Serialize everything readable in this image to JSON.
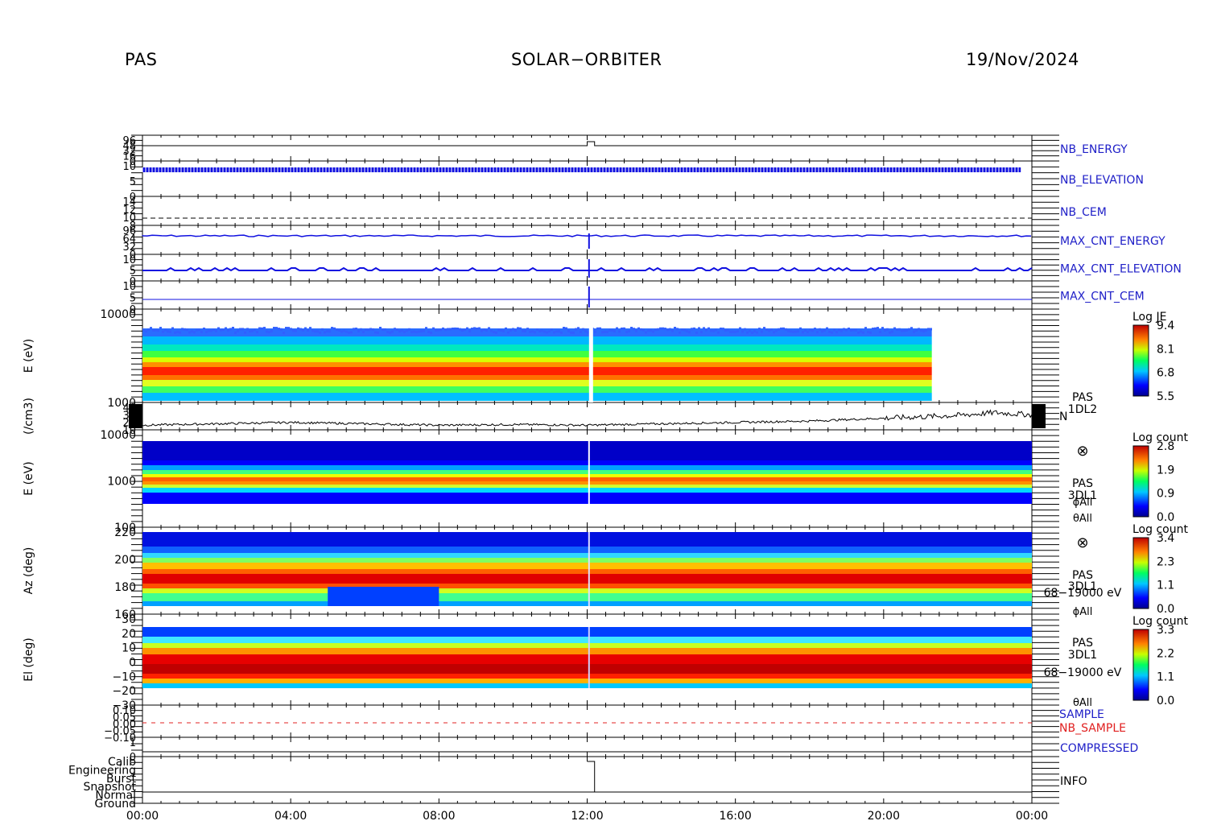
{
  "header": {
    "instrument": "PAS",
    "mission": "SOLAR−ORBITER",
    "date": "19/Nov/2024"
  },
  "colors": {
    "blue_label": "#2020c8",
    "red_label": "#e02020"
  },
  "chart_data": {
    "type": "heatmap",
    "x_ticks": [
      "00:00",
      "04:00",
      "08:00",
      "12:00",
      "16:00",
      "20:00",
      "00:00"
    ],
    "x_range_hours": [
      0,
      24
    ],
    "panels": [
      {
        "key": "nb_energy",
        "type": "line",
        "right_label": "NB_ENERGY",
        "label_color": "#2020c8",
        "tick_labels": [
          "96",
          "48",
          "32",
          "16",
          "0"
        ],
        "note": "step up near 12:00",
        "series": [
          {
            "x": [
              0,
              12.0,
              12.0,
              12.2,
              12.2,
              24
            ],
            "y": [
              0,
              0,
              1,
              1,
              0,
              0
            ]
          }
        ]
      },
      {
        "key": "nb_elevation",
        "type": "line",
        "right_label": "NB_ELEVATION",
        "label_color": "#2020c8",
        "tick_labels": [
          "10",
          "5",
          "0"
        ],
        "series": [
          {
            "x": [
              0,
              23.7
            ],
            "y": [
              9,
              9
            ]
          }
        ]
      },
      {
        "key": "nb_cem",
        "type": "line",
        "right_label": "NB_CEM",
        "label_color": "#2020c8",
        "tick_labels": [
          "14",
          "12",
          "10",
          "8"
        ],
        "series": [
          {
            "x": [
              0,
              24
            ],
            "y": [
              9,
              9
            ]
          }
        ]
      },
      {
        "key": "max_cnt_energy",
        "type": "line",
        "right_label": "MAX_CNT_ENERGY",
        "label_color": "#2020c8",
        "tick_labels": [
          "96",
          "64",
          "32",
          "0"
        ],
        "series": [
          {
            "x": [
              0,
              24
            ],
            "y": [
              60,
              60
            ]
          }
        ]
      },
      {
        "key": "max_cnt_elevation",
        "type": "line",
        "right_label": "MAX_CNT_ELEVATION",
        "label_color": "#2020c8",
        "tick_labels": [
          "10",
          "5",
          "0"
        ],
        "series": [
          {
            "x": [
              0,
              24
            ],
            "y": [
              5,
              5
            ]
          }
        ]
      },
      {
        "key": "max_cnt_cem",
        "type": "line",
        "right_label": "MAX_CNT_CEM",
        "label_color": "#2020c8",
        "tick_labels": [
          "10",
          "5",
          "0"
        ],
        "series": [
          {
            "x": [
              0,
              24
            ],
            "y": [
              2,
              2
            ]
          }
        ]
      },
      {
        "key": "je_spectrogram",
        "type": "heatmap",
        "ylabel": "E (eV)",
        "yscale": "log",
        "tick_labels": [
          "10000",
          "1000"
        ],
        "colorbar_title": "Log JE",
        "colorbar_ticks": [
          "9.4",
          "8.1",
          "6.8",
          "5.5"
        ],
        "data_end_hour": 21.3
      },
      {
        "key": "density",
        "type": "line",
        "ylabel": "(/cm3)",
        "right_label_lines": [
          "PAS",
          "1DL2"
        ],
        "right_inline": "N",
        "tick_labels": [
          "40",
          "30",
          "20",
          "10"
        ],
        "series": [
          {
            "x": [
              0,
              2,
              4,
              6,
              8,
              10,
              12,
              14,
              16,
              18,
              20,
              22,
              23,
              24
            ],
            "y": [
              12,
              14,
              16,
              14,
              12,
              13,
              12,
              14,
              16,
              18,
              22,
              26,
              30,
              27
            ]
          }
        ]
      },
      {
        "key": "count_energy",
        "type": "heatmap",
        "ylabel": "E (eV)",
        "yscale": "log",
        "tick_labels": [
          "10000",
          "1000",
          "100"
        ],
        "right_label_lines": [
          "PAS",
          "3DL1"
        ],
        "right_sub": [
          "ϕAll",
          "θAll"
        ],
        "colorbar_title": "Log count",
        "colorbar_ticks": [
          "2.8",
          "1.9",
          "0.9",
          "0.0"
        ]
      },
      {
        "key": "azimuth",
        "type": "heatmap",
        "ylabel": "Az (deg)",
        "tick_labels": [
          "220",
          "200",
          "180",
          "160"
        ],
        "right_label_lines": [
          "PAS",
          "3DL1"
        ],
        "right_energy": "68−19000 eV",
        "right_sub": [
          "ϕAll"
        ],
        "colorbar_title": "Log count",
        "colorbar_ticks": [
          "3.4",
          "2.3",
          "1.1",
          "0.0"
        ]
      },
      {
        "key": "elevation",
        "type": "heatmap",
        "ylabel": "El (deg)",
        "tick_labels": [
          "30",
          "20",
          "10",
          "0",
          "−10",
          "−20",
          "−30"
        ],
        "right_label_lines": [
          "PAS",
          "3DL1"
        ],
        "right_energy": "68−19000 eV",
        "right_sub": [
          "θAll"
        ],
        "colorbar_title": "Log count",
        "colorbar_ticks": [
          "3.3",
          "2.2",
          "1.1",
          "0.0"
        ]
      },
      {
        "key": "sample",
        "type": "line",
        "right_labels": [
          "SAMPLE",
          "NB_SAMPLE"
        ],
        "tick_labels": [
          "0.10",
          "0.05",
          "0.00",
          "−0.05",
          "−0.10"
        ]
      },
      {
        "key": "compressed",
        "type": "line",
        "right_label": "COMPRESSED",
        "label_color": "#2020c8",
        "tick_labels": [
          "1",
          "0"
        ]
      },
      {
        "key": "info",
        "type": "line",
        "right_label": "INFO",
        "label_color": "#000000",
        "tick_labels": [
          "Calib",
          "Engineering",
          "Burst",
          "Snapshot",
          "Normal",
          "Ground"
        ],
        "series": [
          {
            "x": [
              0,
              12.0,
              12.0,
              12.2,
              12.2,
              24
            ],
            "y": [
              5,
              5,
              0,
              0,
              5,
              5
            ]
          }
        ]
      }
    ]
  }
}
